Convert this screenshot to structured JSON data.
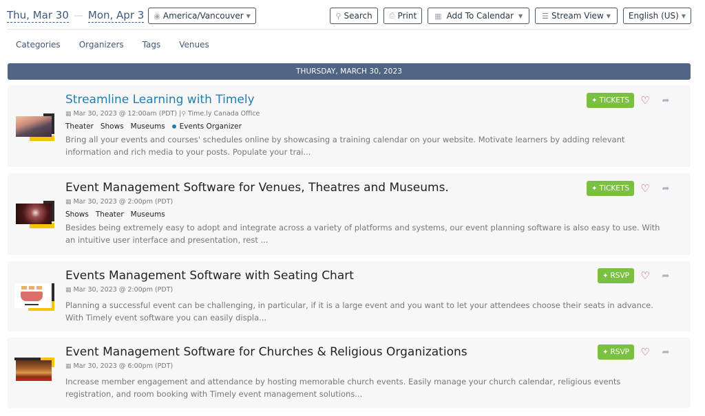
{
  "toolbar": {
    "date_start": "Thu, Mar 30",
    "date_separator": "—",
    "date_end": "Mon, Apr 3",
    "timezone": {
      "icon": "globe-icon",
      "label": "America/Vancouver"
    },
    "search": {
      "icon": "search-icon",
      "label": "Search"
    },
    "print": {
      "icon": "print-icon",
      "label": "Print"
    },
    "add_to_calendar": {
      "icon": "calendar-icon",
      "label": "Add To Calendar"
    },
    "view": {
      "icon": "list-icon",
      "label": "Stream View"
    },
    "language": {
      "label": "English (US)"
    }
  },
  "filters": [
    "Categories",
    "Organizers",
    "Tags",
    "Venues"
  ],
  "day_header": "THURSDAY, MARCH 30, 2023",
  "colors": {
    "accent_blue": "#1f7fb0",
    "header_bar": "#506584",
    "action_green": "#7ac143",
    "heart_red": "#d03030",
    "link_navy": "#3e5879"
  },
  "events": [
    {
      "title": "Streamline Learning with Timely",
      "datetime": "Mar 30, 2023 @ 12:00am (PDT)",
      "venue_separator": "|",
      "venue": "Time.ly Canada Office",
      "tags": [
        "Theater",
        "Shows",
        "Museums"
      ],
      "organizer": "Events Organizer",
      "description": "Bring all your events and courses' schedules online by showcasing a training calendar on your website. Motivate learners by adding relevant information and rich media to your posts. Populate your trai...",
      "action": "TICKETS",
      "image": "hands-framing-city-photo"
    },
    {
      "title": "Event Management Software for Venues, Theatres and Museums.",
      "datetime": "Mar 30, 2023 @ 2:00pm (PDT)",
      "tags": [
        "Shows",
        "Theater",
        "Museums"
      ],
      "description": "Besides being extremely easy to adopt and integrate across a variety of platforms and systems, our event planning software is also easy to use. With an intuitive user interface and presentation, rest ...",
      "action": "TICKETS",
      "image": "ballet-dancer-stage-photo"
    },
    {
      "title": "Events Management Software with Seating Chart",
      "datetime": "Mar 30, 2023 @ 2:00pm (PDT)",
      "description": "Planning a successful event can be challenging, in particular, if it is a large event and you want to let your attendees choose their seats in advance. With Timely event software you can easily displa...",
      "action": "RSVP",
      "image": "seating-chart-diagram"
    },
    {
      "title": "Event Management Software for Churches & Religious Organizations",
      "datetime": "Mar 30, 2023 @ 6:00pm (PDT)",
      "description": "Increase member engagement and attendance by hosting memorable church events. Easily manage your church calendar, religious events registration, and room booking with Timely event management solutions...",
      "action": "RSVP",
      "image": "church-interior-photo"
    }
  ]
}
